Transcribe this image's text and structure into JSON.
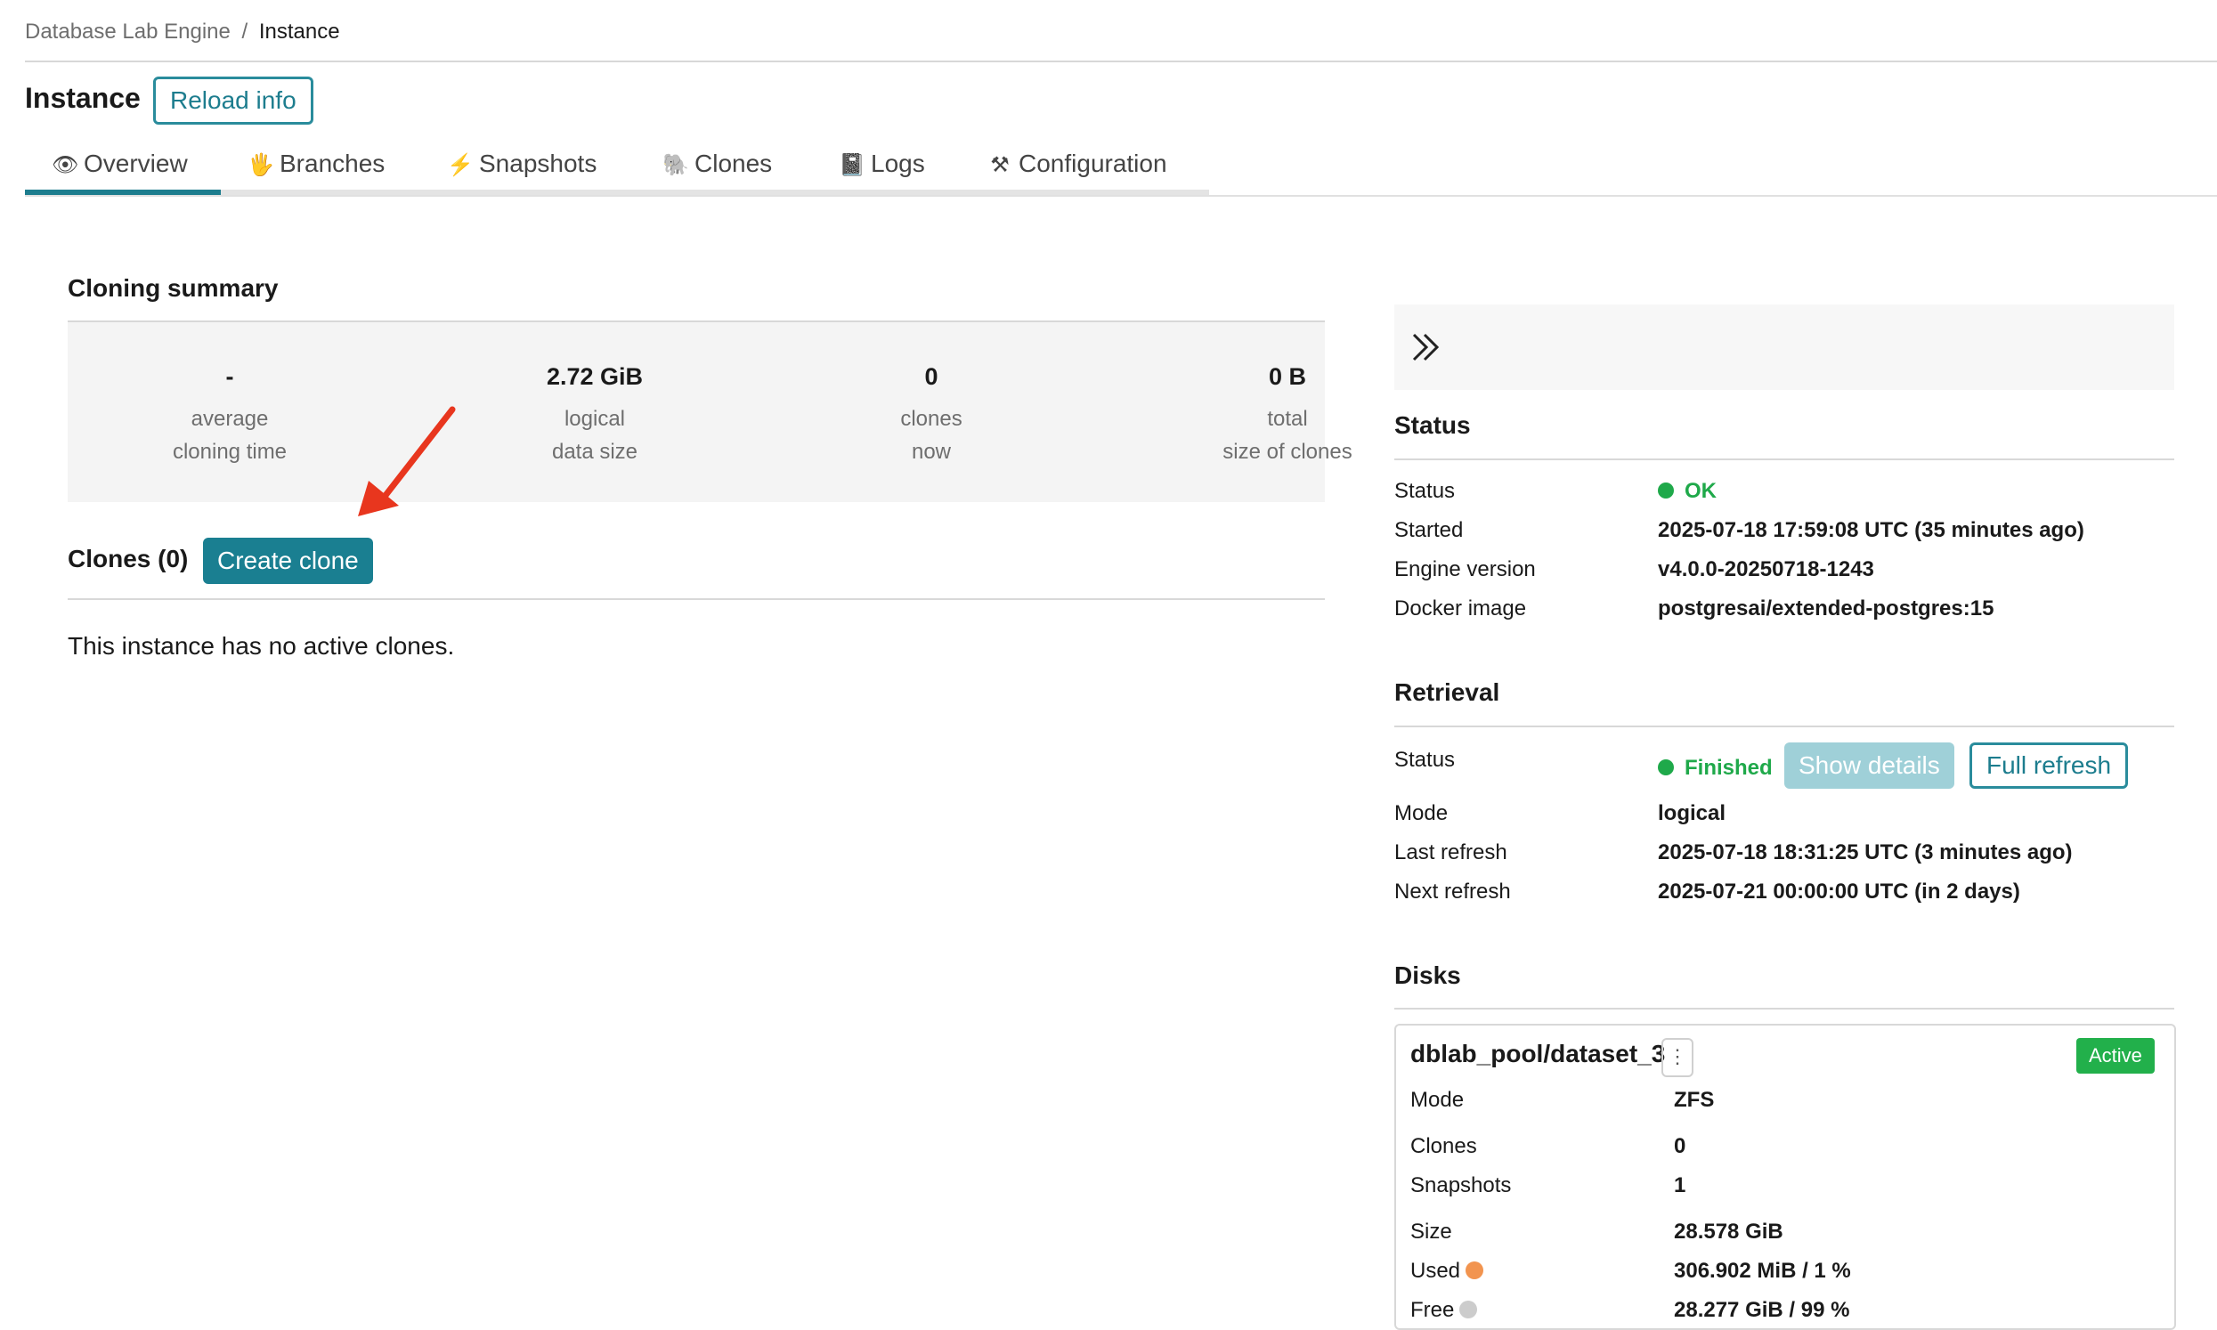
{
  "breadcrumb": {
    "root": "Database Lab Engine",
    "separator": "/",
    "current": "Instance"
  },
  "header": {
    "title": "Instance",
    "reload_label": "Reload info"
  },
  "tabs": [
    {
      "label": "Overview",
      "icon": "eye-icon",
      "active": true
    },
    {
      "label": "Branches",
      "icon": "hand-icon"
    },
    {
      "label": "Snapshots",
      "icon": "lightning-icon"
    },
    {
      "label": "Clones",
      "icon": "elephant-icon"
    },
    {
      "label": "Logs",
      "icon": "notebook-icon"
    },
    {
      "label": "Configuration",
      "icon": "tools-icon"
    }
  ],
  "cloning_summary": {
    "title": "Cloning summary",
    "stats": [
      {
        "value": "-",
        "label_line1": "average",
        "label_line2": "cloning time"
      },
      {
        "value": "2.72 GiB",
        "label_line1": "logical",
        "label_line2": "data size"
      },
      {
        "value": "0",
        "label_line1": "clones",
        "label_line2": "now"
      },
      {
        "value": "0 B",
        "label_line1": "total",
        "label_line2": "size of clones"
      }
    ]
  },
  "clones": {
    "title": "Clones (0)",
    "create_label": "Create clone",
    "empty_text": "This instance has no active clones."
  },
  "status": {
    "title": "Status",
    "rows": [
      {
        "key": "Status",
        "value": "OK"
      },
      {
        "key": "Started",
        "value": "2025-07-18 17:59:08 UTC (35 minutes ago)"
      },
      {
        "key": "Engine version",
        "value": "v4.0.0-20250718-1243"
      },
      {
        "key": "Docker image",
        "value": "postgresai/extended-postgres:15"
      }
    ]
  },
  "retrieval": {
    "title": "Retrieval",
    "status_key": "Status",
    "status_value": "Finished",
    "show_details_label": "Show details",
    "full_refresh_label": "Full refresh",
    "rows": [
      {
        "key": "Mode",
        "value": "logical"
      },
      {
        "key": "Last refresh",
        "value": "2025-07-18 18:31:25 UTC (3 minutes ago)"
      },
      {
        "key": "Next refresh",
        "value": "2025-07-21 00:00:00 UTC (in 2 days)"
      }
    ]
  },
  "disks": {
    "title": "Disks",
    "items": [
      {
        "name": "dblab_pool/dataset_3",
        "badge": "Active",
        "rows": [
          {
            "key": "Mode",
            "value": "ZFS"
          },
          {
            "key": "Clones",
            "value": "0"
          },
          {
            "key": "Snapshots",
            "value": "1"
          },
          {
            "key": "Size",
            "value": "28.578 GiB"
          },
          {
            "key": "Used",
            "value": "306.902 MiB / 1 %"
          },
          {
            "key": "Free",
            "value": "28.277 GiB / 99 %"
          }
        ]
      }
    ]
  },
  "colors": {
    "accent": "#1a7f91",
    "ok_green": "#1fa94a",
    "used_dot": "#f2944f",
    "free_dot": "#cccccc",
    "annotation_arrow": "#e8361e"
  }
}
